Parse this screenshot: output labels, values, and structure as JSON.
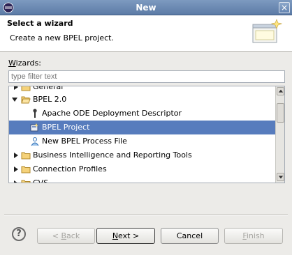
{
  "window": {
    "title": "New",
    "close_glyph": "×"
  },
  "header": {
    "title": "Select a wizard",
    "description": "Create a new BPEL project."
  },
  "wizards_label": {
    "mnemonic": "W",
    "rest": "izards:"
  },
  "filter": {
    "placeholder": "type filter text"
  },
  "tree": {
    "items": [
      {
        "label": "General",
        "icon": "folder-icon",
        "expanded": false
      },
      {
        "label": "BPEL 2.0",
        "icon": "folder-icon",
        "expanded": true
      },
      {
        "label": "Apache ODE Deployment Descriptor",
        "icon": "deployment-descriptor-icon"
      },
      {
        "label": "BPEL Project",
        "icon": "bpel-project-icon",
        "selected": true
      },
      {
        "label": "New BPEL Process File",
        "icon": "process-file-icon"
      },
      {
        "label": "Business Intelligence and Reporting Tools",
        "icon": "folder-icon",
        "expanded": false
      },
      {
        "label": "Connection Profiles",
        "icon": "folder-icon",
        "expanded": false
      },
      {
        "label": "CVS",
        "icon": "folder-icon",
        "expanded": false
      }
    ]
  },
  "buttons": {
    "help_glyph": "?",
    "back": {
      "pre": "< ",
      "mnemonic": "B",
      "post": "ack",
      "enabled": false
    },
    "next": {
      "pre": "",
      "mnemonic": "N",
      "post": "ext >",
      "enabled": true
    },
    "cancel": {
      "label": "Cancel",
      "enabled": true
    },
    "finish": {
      "mnemonic": "F",
      "post": "inish",
      "enabled": false
    }
  },
  "colors": {
    "selection": "#577cbd",
    "titlebar": "#6a88b3"
  }
}
